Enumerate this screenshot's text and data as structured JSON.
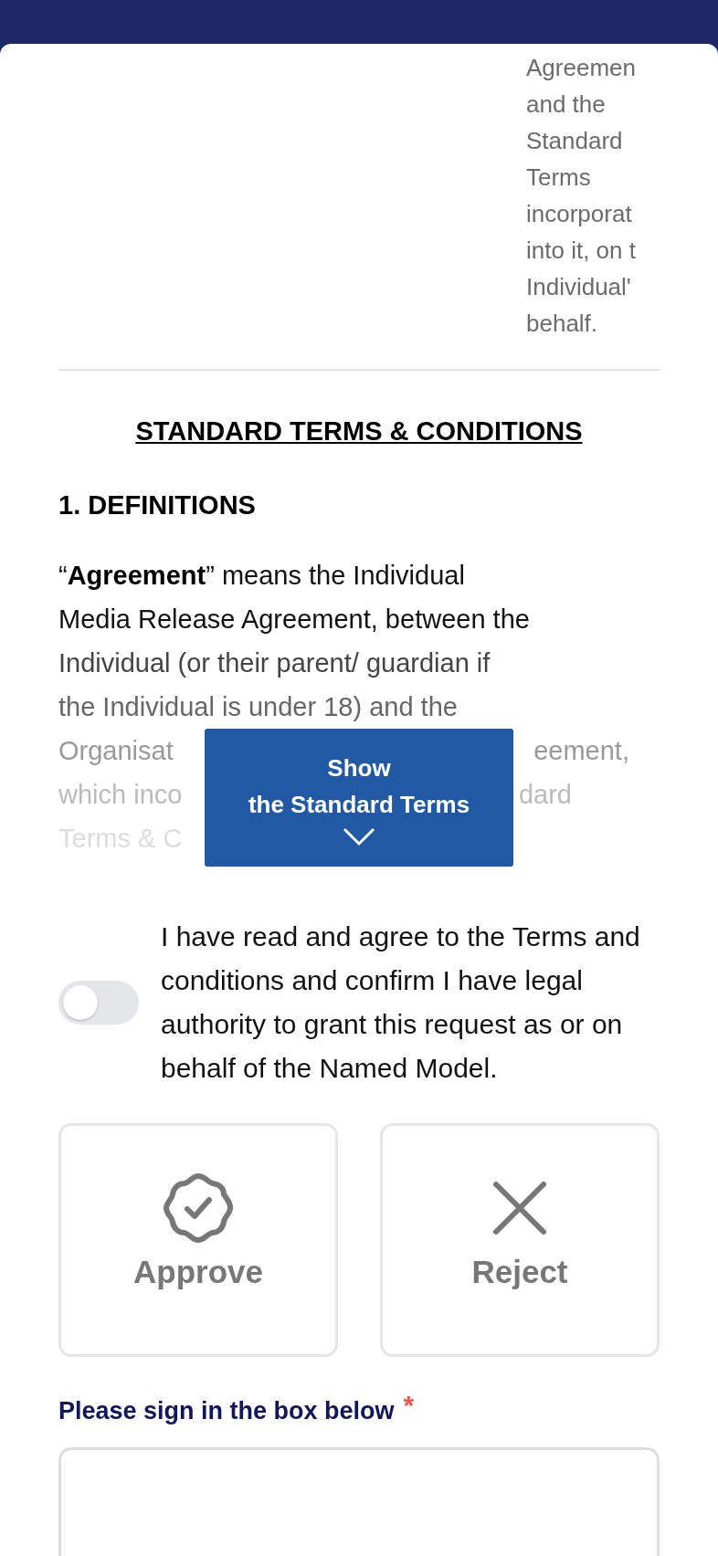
{
  "intro_fragment": {
    "lines": [
      "Agreemen",
      "and the",
      "Standard",
      "Terms",
      "incorporat",
      "into it, on t",
      "Individual'",
      "behalf."
    ]
  },
  "section_title": "STANDARD TERMS & CONDITIONS",
  "definitions": {
    "heading": "1. DEFINITIONS",
    "lines": [
      "“**Agreement**” means the Individual",
      "Media Release Agreement, between the",
      "Individual (or their parent/ guardian if",
      "the Individual is under 18) and the"
    ],
    "faded_lines": [
      {
        "left": "Organisat",
        "right": "eement,"
      },
      {
        "left": "which inco",
        "right": "dard"
      },
      {
        "left": "Terms & C"
      }
    ]
  },
  "show_terms_button": {
    "lines": [
      "Show",
      "the Standard Terms"
    ]
  },
  "consent": {
    "on": false,
    "text": "I have read and agree to the Terms and conditions and confirm I have legal authority to grant this request as or on behalf of the Named Model."
  },
  "decisions": [
    {
      "kind": "approve",
      "label": "Approve",
      "selected": false
    },
    {
      "kind": "reject",
      "label": "Reject",
      "selected": false
    }
  ],
  "signature": {
    "label": "Please sign in the box below",
    "required_mark": "*"
  }
}
